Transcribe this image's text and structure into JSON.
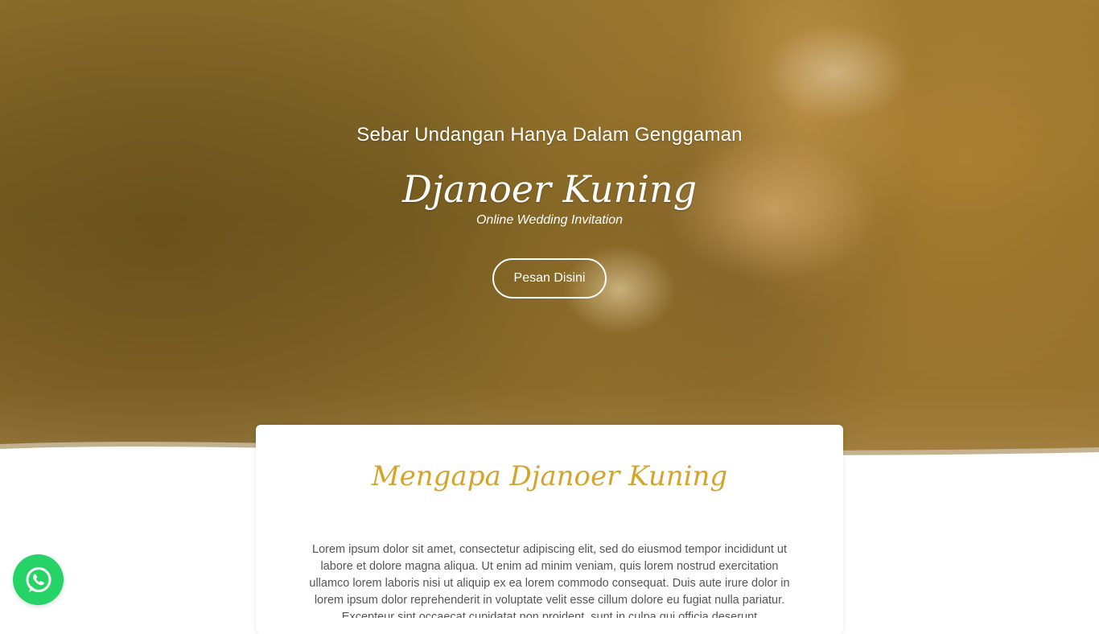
{
  "hero": {
    "tagline": "Sebar Undangan Hanya Dalam Genggaman",
    "brand": "Djanoer Kuning",
    "subtitle": "Online Wedding Invitation",
    "cta_label": "Pesan Disini",
    "background_image": "wedding-bouquet-photo"
  },
  "about": {
    "title": "Mengapa Djanoer Kuning",
    "body": "Lorem ipsum dolor sit amet, consectetur adipiscing elit, sed do eiusmod tempor incididunt ut labore et dolore magna aliqua. Ut enim ad minim veniam, quis lorem nostrud exercitation ullamco lorem laboris nisi ut aliquip ex ea lorem commodo consequat. Duis aute irure dolor in lorem ipsum dolor reprehenderit in voluptate velit esse cillum dolore eu fugiat nulla pariatur. Excepteur sint occaecat cupidatat non proident, sunt in culpa qui officia deserunt"
  },
  "floating": {
    "whatsapp_icon": "whatsapp-icon"
  },
  "colors": {
    "accent": "#d4a52a",
    "whatsapp": "#25d366",
    "body_text": "#555555"
  }
}
